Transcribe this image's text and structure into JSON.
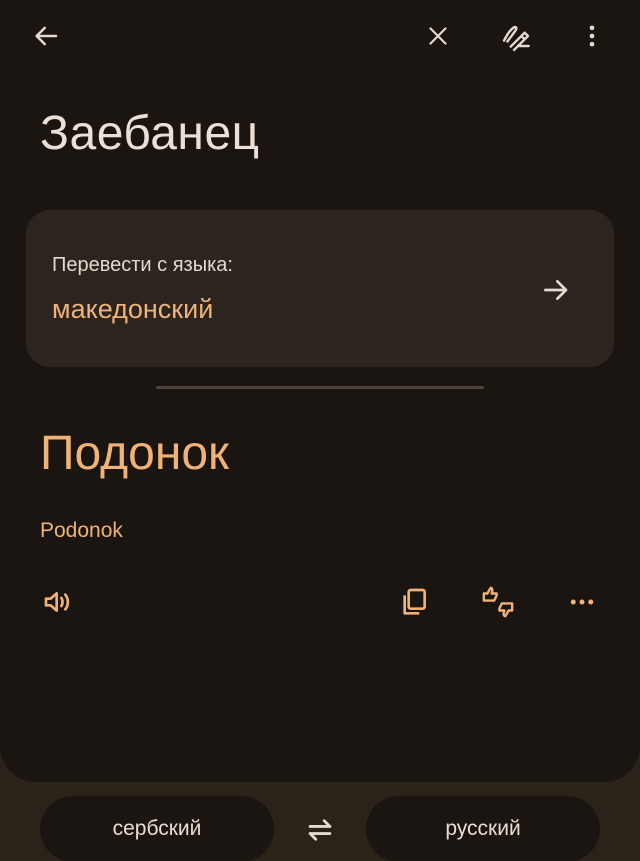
{
  "topbar": {
    "back_icon": "arrow-left-icon",
    "clear_icon": "close-icon",
    "handwriting_icon": "handwriting-icon",
    "menu_icon": "more-vert-icon"
  },
  "source": {
    "text": "Заебанец"
  },
  "detect_card": {
    "label": "Перевести с языка:",
    "language": "македонский",
    "arrow_icon": "arrow-right-icon"
  },
  "result": {
    "translation": "Подонок",
    "transliteration": "Podonok"
  },
  "actions": {
    "speak_icon": "volume-icon",
    "copy_icon": "copy-icon",
    "feedback_icon": "thumbs-up-down-icon",
    "more_icon": "more-horiz-icon"
  },
  "languages": {
    "source_language": "сербский",
    "target_language": "русский",
    "swap_icon": "swap-arrows-icon"
  },
  "colors": {
    "panel_bg": "#1b1512",
    "outer_bg": "#2a2319",
    "card_bg": "#2b241f",
    "accent": "#f0b276",
    "text_primary": "#ece0d6"
  }
}
